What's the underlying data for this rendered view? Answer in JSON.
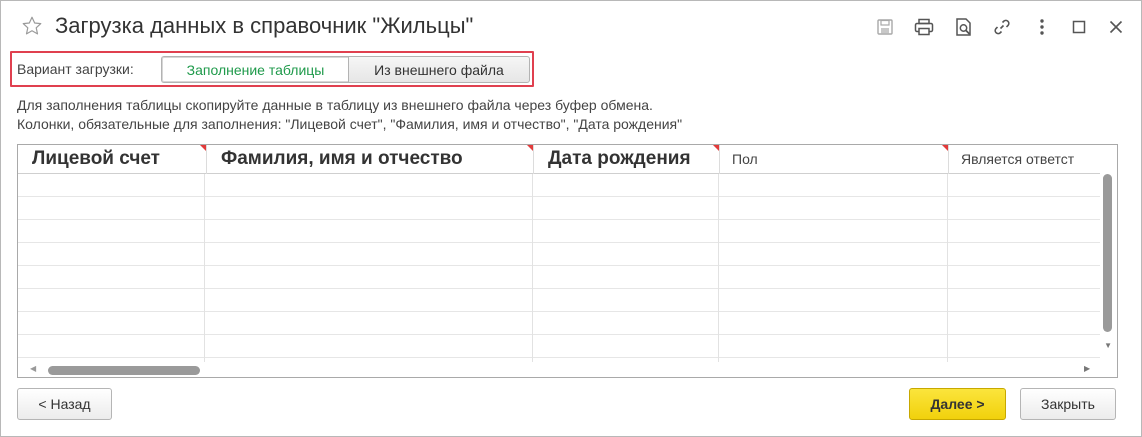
{
  "window": {
    "title": "Загрузка данных в справочник \"Жильцы\""
  },
  "title_bar": {
    "icons": [
      "star-icon",
      "save-icon",
      "print-icon",
      "preview-icon",
      "link-icon",
      "more-icon",
      "maximize-icon",
      "close-icon"
    ]
  },
  "variant": {
    "label": "Вариант загрузки:",
    "options": [
      "Заполнение таблицы",
      "Из внешнего файла"
    ],
    "selected": "Заполнение таблицы",
    "highlight_color": "#e0404f",
    "active_text_color": "#1f9a4b"
  },
  "info": {
    "line1": "Для заполнения таблицы скопируйте данные в таблицу из внешнего файла через буфер обмена.",
    "line2": "Колонки, обязательные для заполнения: \"Лицевой счет\", \"Фамилия, имя и отчество\", \"Дата рождения\""
  },
  "table": {
    "columns": [
      {
        "label": "Лицевой счет",
        "required": true
      },
      {
        "label": "Фамилия, имя и отчество",
        "required": true
      },
      {
        "label": "Дата рождения",
        "required": true
      },
      {
        "label": "Пол",
        "required": true
      },
      {
        "label": "Является ответст",
        "required": false
      }
    ],
    "rows": [],
    "required_marker_color": "#e23b3b"
  },
  "buttons": {
    "back": "< Назад",
    "next": "Далее >",
    "close": "Закрыть",
    "next_color": "#f1d10c"
  }
}
